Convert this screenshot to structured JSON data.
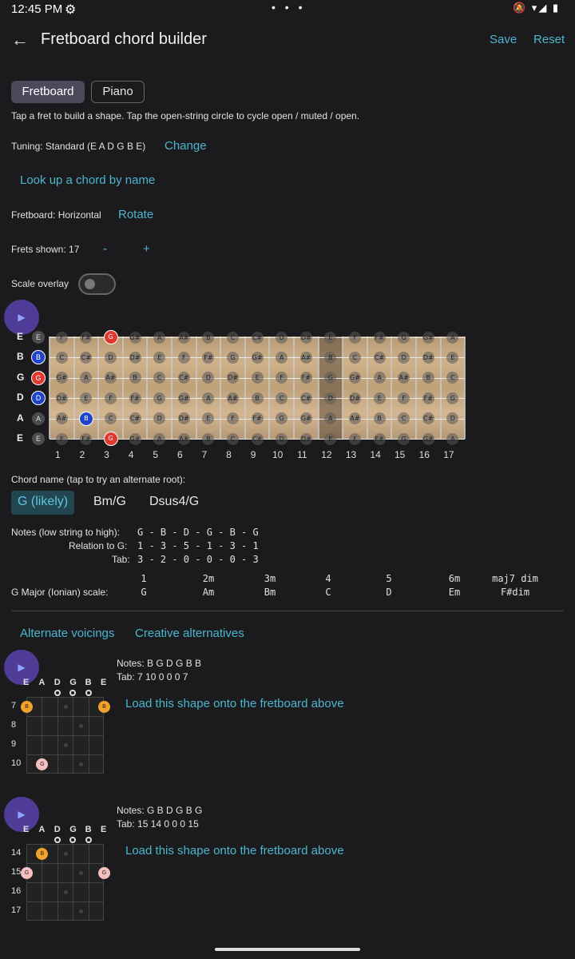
{
  "status": {
    "time": "12:45 PM",
    "gear": "⚙",
    "dots": "• • •",
    "right": "🔕 ▾◢ ▮"
  },
  "appbar": {
    "title": "Fretboard chord builder",
    "back": "←",
    "save": "Save",
    "reset": "Reset"
  },
  "tabs": {
    "fretboard": "Fretboard",
    "piano": "Piano"
  },
  "instructions": "Tap a fret to build a shape. Tap the open-string circle to cycle open / muted / open.",
  "tuning": {
    "label": "Tuning: Standard (E A D G B E)",
    "change": "Change"
  },
  "lookup": "Look up a chord by name",
  "orientation": {
    "label": "Fretboard: Horizontal",
    "rotate": "Rotate"
  },
  "frets_shown": {
    "label": "Frets shown: 17",
    "minus": "-",
    "plus": "+"
  },
  "scale_overlay": {
    "label": "Scale overlay",
    "on": false
  },
  "play_icon": "▶",
  "fretboard": {
    "strings": [
      "E",
      "B",
      "G",
      "D",
      "A",
      "E"
    ],
    "open": [
      "E",
      "B",
      "G",
      "D",
      "A",
      "E"
    ],
    "open_state": [
      "open",
      "sel",
      "root",
      "sel",
      "open",
      "open"
    ],
    "fret_numbers": [
      "1",
      "2",
      "3",
      "4",
      "5",
      "6",
      "7",
      "8",
      "9",
      "10",
      "11",
      "12",
      "13",
      "14",
      "15",
      "16",
      "17"
    ],
    "rows": [
      [
        "F",
        "F#",
        "G",
        "G#",
        "A",
        "A#",
        "B",
        "C",
        "C#",
        "D",
        "D#",
        "E",
        "F",
        "F#",
        "G",
        "G#",
        "A"
      ],
      [
        "C",
        "C#",
        "D",
        "D#",
        "E",
        "F",
        "F#",
        "G",
        "G#",
        "A",
        "A#",
        "B",
        "C",
        "C#",
        "D",
        "D#",
        "E"
      ],
      [
        "G#",
        "A",
        "A#",
        "B",
        "C",
        "C#",
        "D",
        "D#",
        "E",
        "F",
        "F#",
        "G",
        "G#",
        "A",
        "A#",
        "B",
        "C"
      ],
      [
        "D#",
        "E",
        "F",
        "F#",
        "G",
        "G#",
        "A",
        "A#",
        "B",
        "C",
        "C#",
        "D",
        "D#",
        "E",
        "F",
        "F#",
        "G"
      ],
      [
        "A#",
        "B",
        "C",
        "C#",
        "D",
        "D#",
        "E",
        "F",
        "F#",
        "G",
        "G#",
        "A",
        "A#",
        "B",
        "C",
        "C#",
        "D"
      ],
      [
        "F",
        "F#",
        "G",
        "G#",
        "A",
        "A#",
        "B",
        "C",
        "C#",
        "D",
        "D#",
        "E",
        "F",
        "F#",
        "G",
        "G#",
        "A"
      ]
    ],
    "highlights": [
      {
        "string": 0,
        "fret": 3,
        "kind": "root"
      },
      {
        "string": 4,
        "fret": 2,
        "kind": "sel"
      },
      {
        "string": 5,
        "fret": 3,
        "kind": "root"
      }
    ]
  },
  "chord_name": {
    "label": "Chord name (tap to try an alternate root):",
    "options": [
      "G (likely)",
      "Bm/G",
      "Dsus4/G"
    ]
  },
  "analysis": {
    "notes_label": "Notes (low string to high):",
    "notes": "G - B - D - G - B - G",
    "relation_label": "Relation to G:",
    "relation": "1 - 3 - 5 - 1 - 3 - 1",
    "tab_label": "Tab:",
    "tab": "3 - 2 - 0 - 0 - 0 - 3"
  },
  "scale": {
    "label": "G Major (Ionian) scale:",
    "degrees": [
      "1",
      "2m",
      "3m",
      "4",
      "5",
      "6m",
      "maj7 dim"
    ],
    "chords": [
      "G",
      "Am",
      "Bm",
      "C",
      "D",
      "Em",
      "F#dim"
    ]
  },
  "alt_tabs": {
    "voicings": "Alternate voicings",
    "creative": "Creative alternatives"
  },
  "voicings": [
    {
      "notes": "Notes: B G D G B B",
      "tab": "Tab: 7 10 0 0 0 7",
      "load": "Load this shape onto the fretboard above",
      "strings": [
        "E",
        "A",
        "D",
        "G",
        "B",
        "E"
      ],
      "frets": [
        "7",
        "8",
        "9",
        "10"
      ]
    },
    {
      "notes": "Notes: G B D G B G",
      "tab": "Tab: 15 14 0 0 0 15",
      "load": "Load this shape onto the fretboard above",
      "strings": [
        "E",
        "A",
        "D",
        "G",
        "B",
        "E"
      ],
      "frets": [
        "14",
        "15",
        "16",
        "17"
      ]
    }
  ],
  "colors": {
    "accent": "#4bb6cf",
    "root": "#e0382f",
    "selected": "#1f43c9",
    "play": "#4f3c97"
  }
}
